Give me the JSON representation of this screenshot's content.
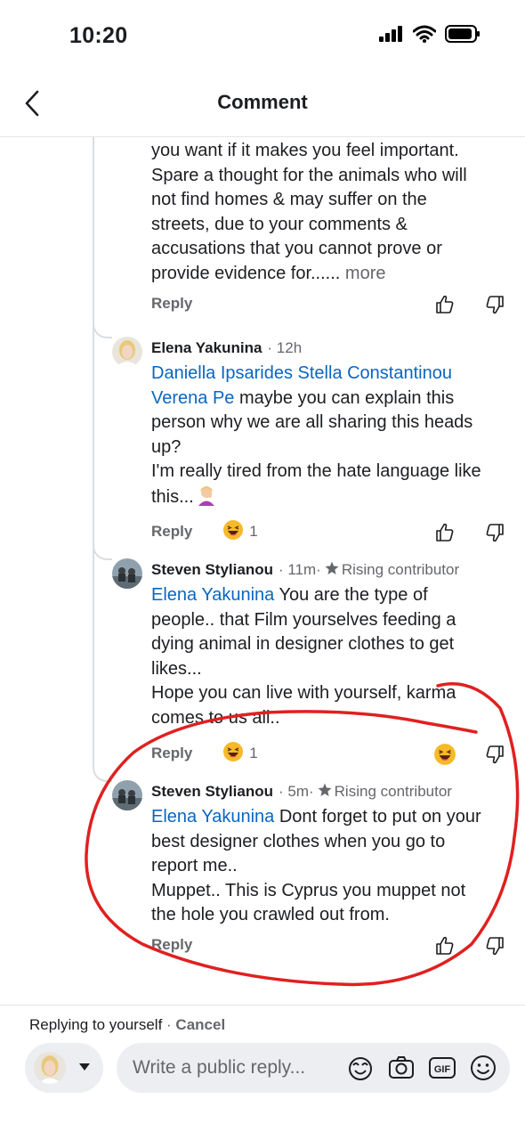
{
  "status_bar": {
    "time": "10:20"
  },
  "nav": {
    "title": "Comment"
  },
  "comments": [
    {
      "text_lines": [
        "you want if it makes you feel important.",
        "Spare a thought for the animals who will",
        "not find homes & may suffer on the",
        "streets, due to your comments &",
        "accusations that you cannot prove or"
      ],
      "last_line": "provide evidence for......",
      "more_label": "more",
      "reply_label": "Reply"
    },
    {
      "author": "Elena Yakunina",
      "time": "· 12h",
      "mention_line1": "Daniella Ipsarides Stella Constantinou",
      "mention_line2": "Verena Pe",
      "line2_rest": " maybe you can explain this",
      "text_lines": [
        "person why we are all sharing this heads",
        "up?",
        "I'm really tired from the hate language like"
      ],
      "last_line": "this...",
      "reply_label": "Reply",
      "reaction_count": "1"
    },
    {
      "author": "Steven Stylianou",
      "time": "· 11m·",
      "badge": "Rising contributor",
      "mention": "Elena Yakunina",
      "line1_rest": " You are the type of",
      "text_lines": [
        "people.. that Film yourselves feeding a",
        "dying animal in designer clothes to get",
        "likes...",
        "Hope you can live with yourself, karma",
        "comes to us all.."
      ],
      "reply_label": "Reply",
      "reaction_count": "1"
    },
    {
      "author": "Steven Stylianou",
      "time": "· 5m·",
      "badge": "Rising contributor",
      "mention": "Elena Yakunina",
      "line1_rest": " Dont forget to put on your",
      "text_lines": [
        "best designer clothes when you go to",
        "report me..",
        "Muppet.. This is Cyprus you muppet not",
        "the hole you crawled out from."
      ],
      "reply_label": "Reply"
    }
  ],
  "composer": {
    "replying_to": "Replying to yourself",
    "separator": " · ",
    "cancel_label": "Cancel",
    "placeholder": "Write a public reply..."
  },
  "icons": {
    "back": "chevron-left-icon",
    "signal": "cellular-signal-icon",
    "wifi": "wifi-icon",
    "battery": "battery-icon",
    "like": "thumbs-up-icon",
    "dislike": "thumbs-down-icon",
    "reaction": "laughing-emoji-icon",
    "badge": "star-icon",
    "sticker": "sticker-icon",
    "camera": "camera-icon",
    "gif": "gif-icon",
    "emoji": "smiley-icon"
  },
  "colors": {
    "mention": "#0a66c2",
    "meta": "#65676b",
    "annotation": "#e02020"
  }
}
